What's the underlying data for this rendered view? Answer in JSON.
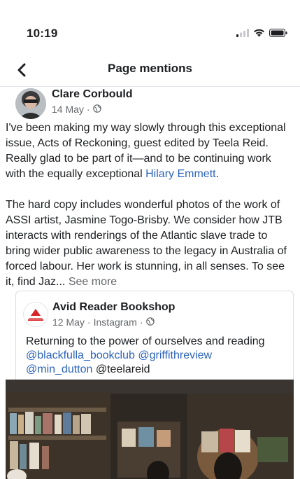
{
  "status_bar": {
    "time": "10:19"
  },
  "nav": {
    "title": "Page mentions"
  },
  "post": {
    "author": "Clare Corbould",
    "date": "14 May",
    "separator": " · ",
    "paragraph1_part1": "I've been making my way slowly through this exceptional issue, Acts of Reckoning, guest edited by Teela Reid.  Really glad to be part of it—and to be continuing work with the equally exceptional ",
    "paragraph1_link": "Hilary Emmett",
    "paragraph1_end": ".",
    "paragraph2": "The hard copy includes wonderful photos of the work of ASSI artist, Jasmine Togo-Brisby. We consider how JTB interacts with renderings of the Atlantic slave trade to bring wider public awareness to the legacy in Australia of forced labour. Her work is stunning, in all senses. To see it, find Jaz...",
    "see_more": " See more"
  },
  "shared_post": {
    "author": "Avid Reader Bookshop",
    "date": "12 May",
    "source": "Instagram",
    "separator": " · ",
    "text": "Returning to the power of ourselves and reading",
    "mentions": [
      "@blackfulla_bookclub",
      "@griffithreview",
      "@min_dutton"
    ],
    "plain_mention": "@teelareid"
  },
  "colors": {
    "link": "#2d64bc",
    "meta": "#65676b",
    "logo_red": "#d9252a"
  },
  "icons": [
    "back-chevron-icon",
    "signal-icon",
    "wifi-icon",
    "battery-icon",
    "globe-icon",
    "bookshop-logo-icon"
  ]
}
